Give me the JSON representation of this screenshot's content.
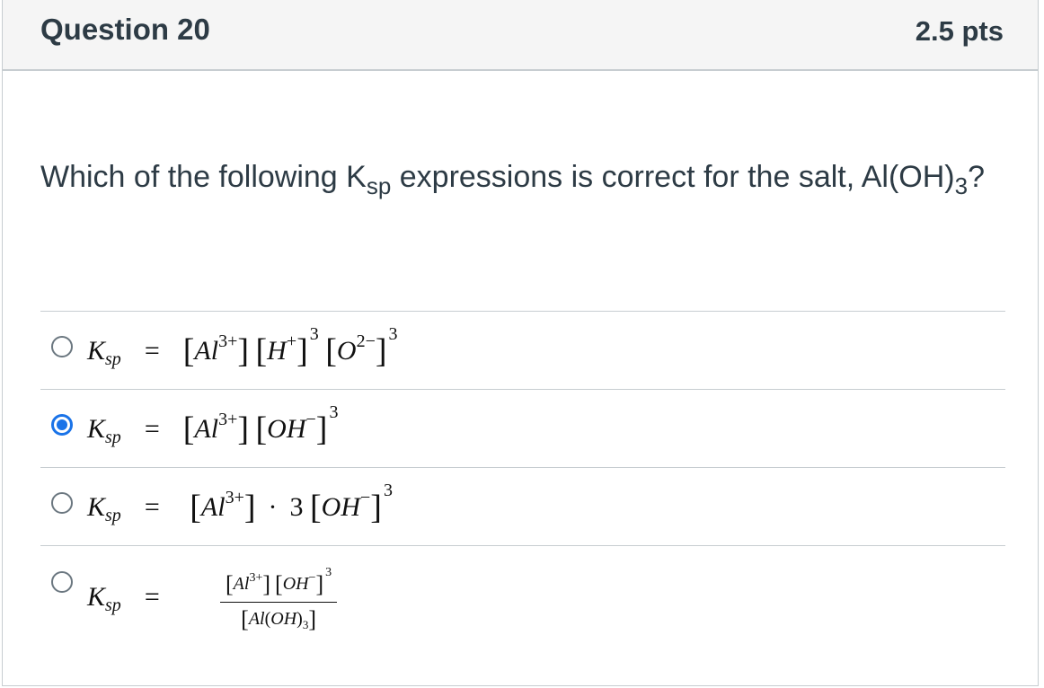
{
  "question": {
    "title": "Question 20",
    "points": "2.5 pts",
    "text_part1": "Which of the following K",
    "text_sub": "sp",
    "text_part2": " expressions is correct for the salt, Al(OH)",
    "text_sub2": "3",
    "text_part3": "?"
  },
  "answers": [
    {
      "id": "a",
      "selected": false,
      "latex": "K_{sp} = [Al^{3+}][H^+]^3[O^{2-}]^3"
    },
    {
      "id": "b",
      "selected": true,
      "latex": "K_{sp} = [Al^{3+}][OH^-]^3"
    },
    {
      "id": "c",
      "selected": false,
      "latex": "K_{sp} = [Al^{3+}] \\cdot 3[OH^-]^3"
    },
    {
      "id": "d",
      "selected": false,
      "latex": "K_{sp} = \\frac{[Al^{3+}][OH^-]^3}{[Al(OH)_3]}"
    }
  ],
  "colors": {
    "accent": "#1a73e8",
    "header_bg": "#f5f5f5",
    "border": "#c7cdd1",
    "text": "#2d3b45"
  }
}
